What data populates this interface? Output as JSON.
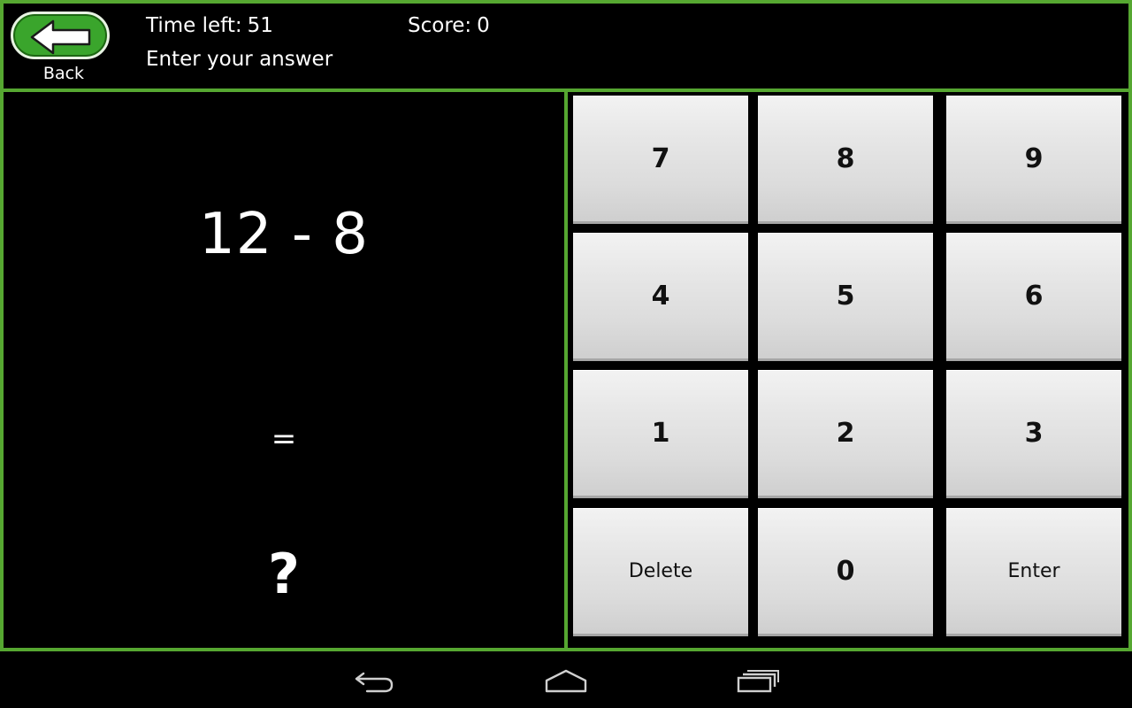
{
  "header": {
    "back_label": "Back",
    "time_left_label": "Time left:",
    "time_left_value": "51",
    "score_label": "Score:",
    "score_value": "0",
    "prompt": "Enter your answer"
  },
  "problem": {
    "expression": "12 - 8",
    "equals": "=",
    "answer": "?"
  },
  "keypad": {
    "keys": [
      "7",
      "8",
      "9",
      "4",
      "5",
      "6",
      "1",
      "2",
      "3",
      "Delete",
      "0",
      "Enter"
    ]
  },
  "colors": {
    "border_green": "#56a731",
    "back_button_green": "#3aa52c",
    "background": "#000000",
    "key_face": "#e0e0e0"
  },
  "navbar": {
    "icons": [
      "back-icon",
      "home-icon",
      "recent-apps-icon"
    ]
  }
}
